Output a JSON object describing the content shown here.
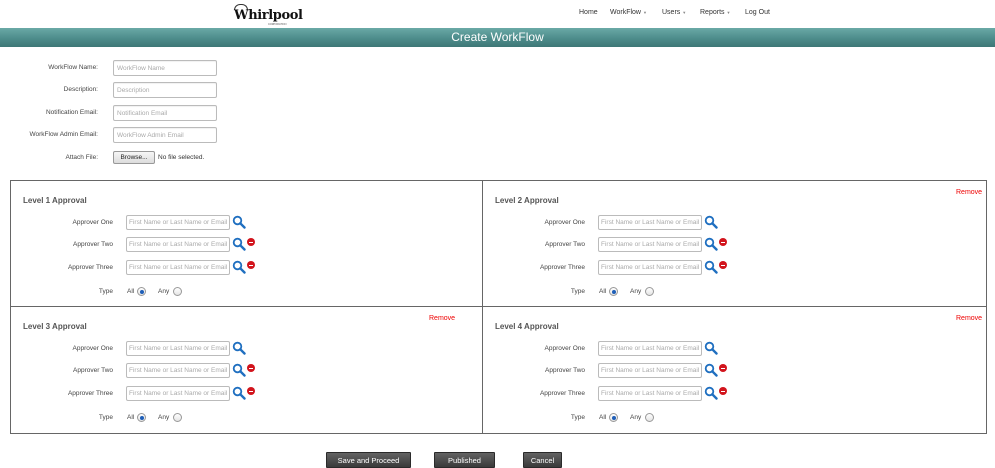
{
  "brand": {
    "name": "Whirlpool",
    "sub": "CORPORATION"
  },
  "nav": [
    {
      "label": "Home",
      "dropdown": false
    },
    {
      "label": "WorkFlow",
      "dropdown": true
    },
    {
      "label": "Users",
      "dropdown": true
    },
    {
      "label": "Reports",
      "dropdown": true
    },
    {
      "label": "Log Out",
      "dropdown": false
    }
  ],
  "page_title": "Create WorkFlow",
  "form": {
    "workflow_name": {
      "label": "WorkFlow Name:",
      "placeholder": "WorkFlow Name"
    },
    "description": {
      "label": "Description:",
      "placeholder": "Description"
    },
    "notification_email": {
      "label": "Notification Email:",
      "placeholder": "Notification Email"
    },
    "admin_email": {
      "label": "WorkFlow Admin Email:",
      "placeholder": "WorkFlow Admin Email"
    },
    "attach_file": {
      "label": "Attach File:",
      "button": "Browse...",
      "status": "No file selected."
    }
  },
  "levels": [
    {
      "title": "Level 1 Approval",
      "remove": ""
    },
    {
      "title": "Level 2 Approval",
      "remove": "Remove"
    },
    {
      "title": "Level 3 Approval",
      "remove": "Remove"
    },
    {
      "title": "Level 4 Approval",
      "remove": "Remove"
    }
  ],
  "approver_labels": [
    "Approver One",
    "Approver Two",
    "Approver Three"
  ],
  "approver_placeholder": "First Name or Last Name or Email",
  "type": {
    "label": "Type",
    "all": "All",
    "any": "Any",
    "selected": "All"
  },
  "buttons": {
    "save": "Save and Proceed",
    "published": "Published",
    "cancel": "Cancel"
  },
  "colors": {
    "band": "#4d8c8b",
    "remove": "#e00000",
    "minus": "#d2141c",
    "search": "#1f6fc0"
  }
}
